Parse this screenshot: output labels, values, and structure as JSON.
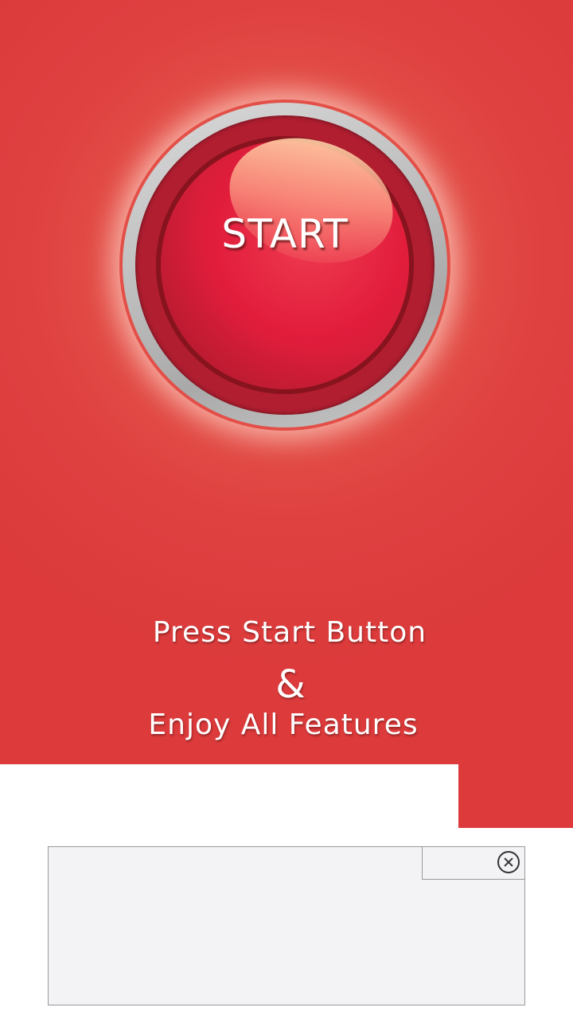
{
  "start_button": {
    "label": "START"
  },
  "caption": {
    "line1": "Press Start Button",
    "line2": "&",
    "line3": "Enjoy All Features"
  },
  "ad": {
    "close_icon": "close-circle-icon"
  },
  "colors": {
    "background_red": "#dc3a3b",
    "button_red": "#e21d3c",
    "ad_background": "#f3f2f5"
  }
}
